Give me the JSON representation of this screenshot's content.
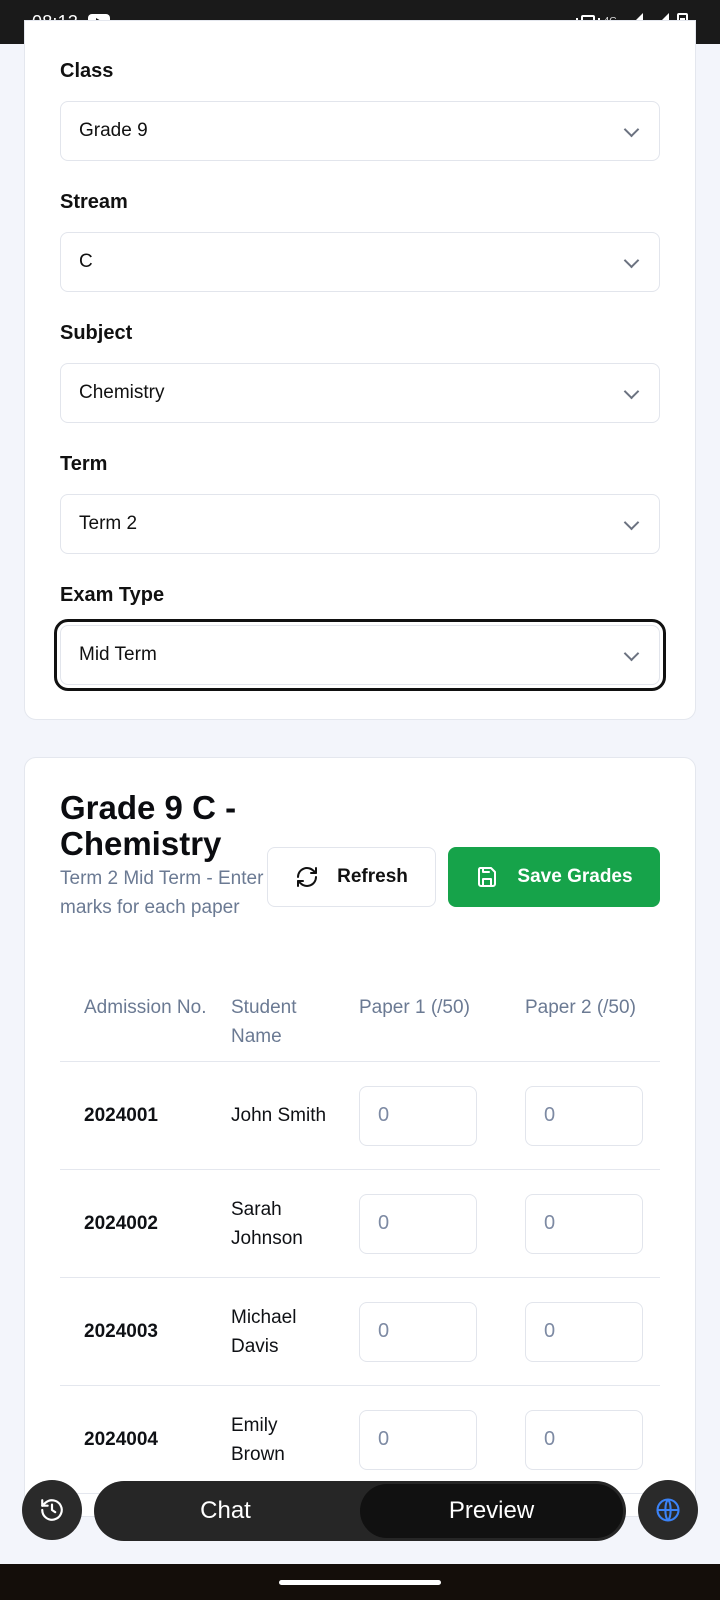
{
  "status_bar": {
    "time": "08:13",
    "network": "4G"
  },
  "filters": [
    {
      "label": "Class",
      "value": "Grade 9"
    },
    {
      "label": "Stream",
      "value": "C"
    },
    {
      "label": "Subject",
      "value": "Chemistry"
    },
    {
      "label": "Term",
      "value": "Term 2"
    },
    {
      "label": "Exam Type",
      "value": "Mid Term"
    }
  ],
  "grades": {
    "title": "Grade 9 C - Chemistry",
    "subtitle": "Term 2 Mid Term - Enter marks for each paper",
    "refresh_label": "Refresh",
    "save_label": "Save Grades",
    "save_color": "#16a34a",
    "columns": [
      "Admission No.",
      "Student Name",
      "Paper 1 (/50)",
      "Paper 2 (/50)"
    ],
    "rows": [
      {
        "admission": "2024001",
        "name": "John Smith",
        "paper1": "0",
        "paper2": "0"
      },
      {
        "admission": "2024002",
        "name": "Sarah Johnson",
        "paper1": "0",
        "paper2": "0"
      },
      {
        "admission": "2024003",
        "name": "Michael Davis",
        "paper1": "0",
        "paper2": "0"
      },
      {
        "admission": "2024004",
        "name": "Emily Brown",
        "paper1": "0",
        "paper2": "0"
      }
    ]
  },
  "bottom_bar": {
    "chat_label": "Chat",
    "preview_label": "Preview"
  }
}
